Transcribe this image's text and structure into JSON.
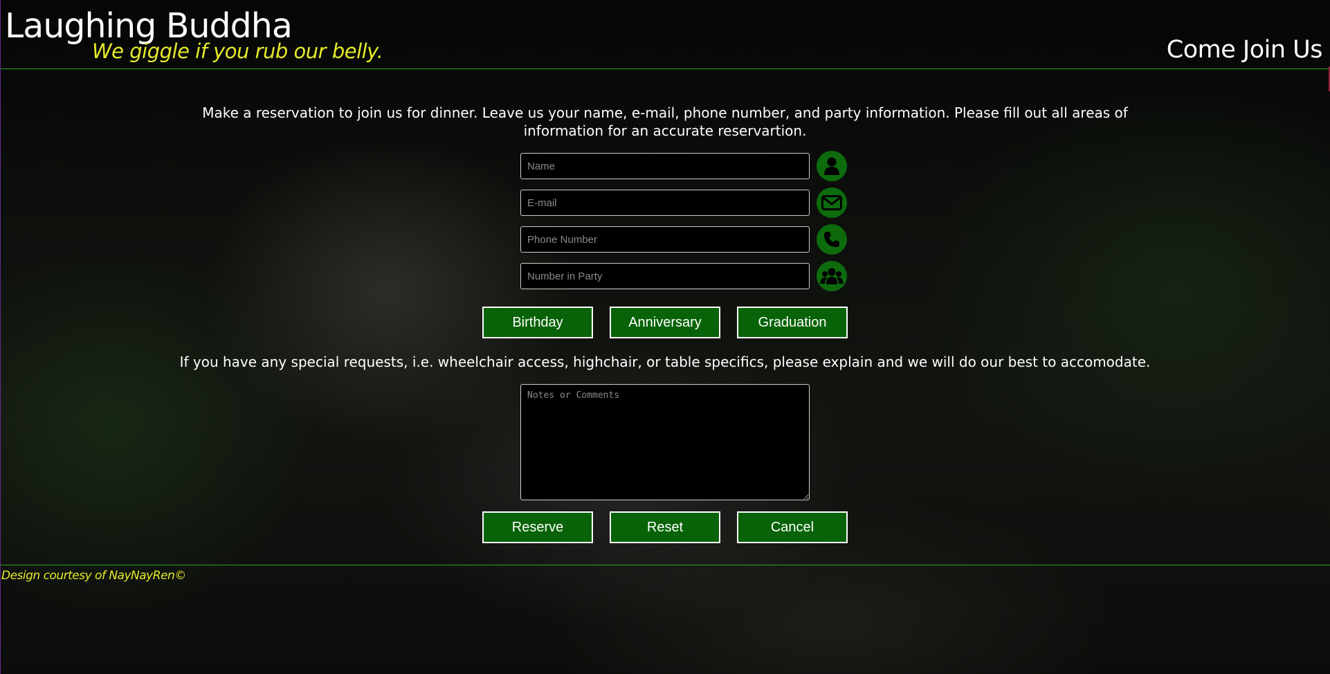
{
  "header": {
    "title": "Laughing Buddha",
    "tagline": "We giggle if you rub our belly.",
    "nav_link": "Come Join Us"
  },
  "intro_text": "Make a reservation to join us for dinner. Leave us your name, e-mail, phone number, and party information. Please fill out all areas of information for an accurate reservartion.",
  "fields": {
    "name": {
      "placeholder": "Name",
      "value": "",
      "icon": "user-icon"
    },
    "email": {
      "placeholder": "E-mail",
      "value": "",
      "icon": "envelope-icon"
    },
    "phone": {
      "placeholder": "Phone Number",
      "value": "",
      "icon": "phone-icon"
    },
    "party": {
      "placeholder": "Number in Party",
      "value": "",
      "icon": "group-icon"
    }
  },
  "occasion_buttons": {
    "birthday": "Birthday",
    "anniversary": "Anniversary",
    "graduation": "Graduation"
  },
  "requests_text": "If you have any special requests, i.e. wheelchair access, highchair, or table specifics, please explain and we will do our best to accomodate.",
  "notes": {
    "placeholder": "Notes or Comments",
    "value": ""
  },
  "action_buttons": {
    "reserve": "Reserve",
    "reset": "Reset",
    "cancel": "Cancel"
  },
  "footer": {
    "credit": "Design courtesy of NayNayRen©"
  },
  "colors": {
    "accent_green": "#086308",
    "rule_green": "#2fa52f",
    "tagline_yellow": "#e6ea2a",
    "background": "#0a0b09"
  }
}
